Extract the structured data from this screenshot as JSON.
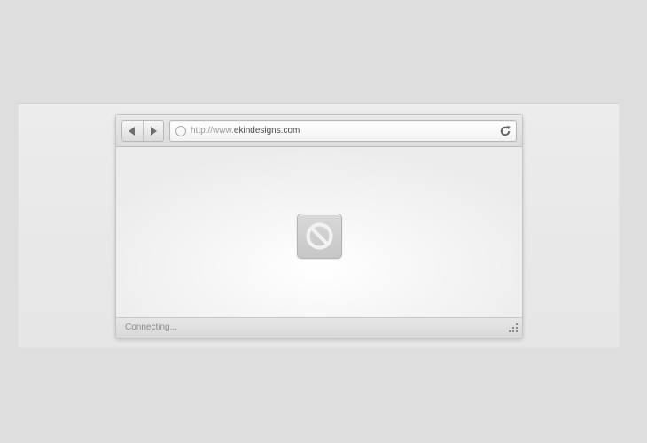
{
  "browser": {
    "address_bar": {
      "url_scheme": "http://www.",
      "url_host": "ekindesigns.com"
    },
    "status": {
      "text": "Connecting..."
    },
    "icons": {
      "back": "back-arrow-icon",
      "forward": "forward-arrow-icon",
      "page": "page-circle-icon",
      "reload": "reload-icon",
      "blocked": "no-entry-icon",
      "resize": "resize-grip-icon"
    },
    "colors": {
      "background": "#dedede",
      "chrome": "#dadada",
      "icon_gray": "#8a8a8a"
    }
  }
}
